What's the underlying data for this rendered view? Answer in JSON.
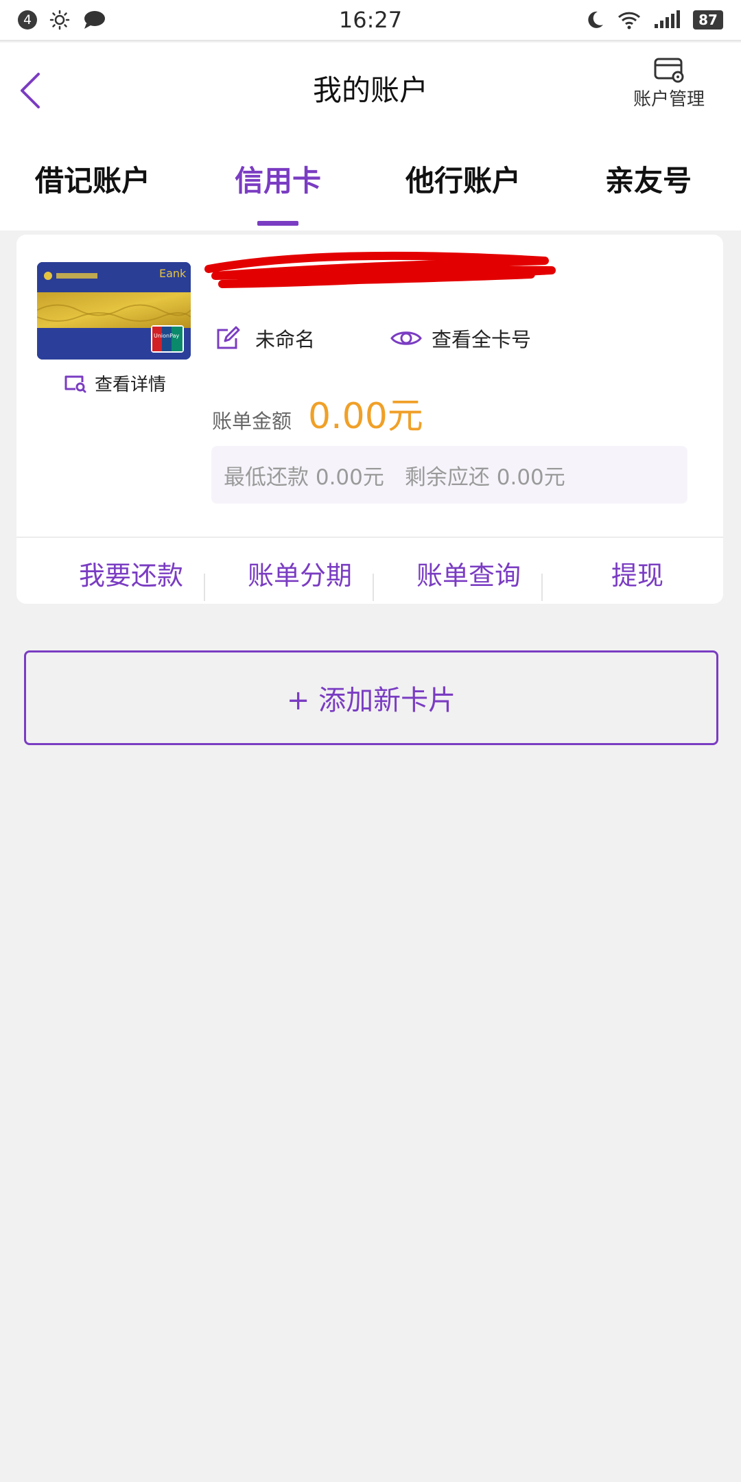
{
  "status_bar": {
    "notification_count": "4",
    "time": "16:27",
    "battery": "87"
  },
  "header": {
    "title": "我的账户",
    "manage_label": "账户管理"
  },
  "tabs": [
    {
      "label": "借记账户"
    },
    {
      "label": "信用卡"
    },
    {
      "label": "他行账户"
    },
    {
      "label": "亲友号"
    }
  ],
  "active_tab": "信用卡",
  "card": {
    "name": "未命名",
    "view_full_number": "查看全卡号",
    "view_detail": "查看详情",
    "bill_label": "账单金额",
    "bill_amount": "0.00元",
    "min_payment": "最低还款 0.00元",
    "remaining": "剩余应还 0.00元",
    "image_brand_text": "Eank",
    "image_network_text": "UnionPay"
  },
  "actions": [
    {
      "label": "我要还款"
    },
    {
      "label": "账单分期"
    },
    {
      "label": "账单查询"
    },
    {
      "label": "提现"
    }
  ],
  "add_card_label": "+ 添加新卡片",
  "colors": {
    "accent": "#7a3cc2",
    "amount": "#f0a028",
    "background": "#f1f1f1",
    "redaction": "#e30000"
  },
  "icons": {
    "back": "chevron-left-icon",
    "manage": "card-settings-icon",
    "rename": "edit-icon",
    "view": "eye-icon",
    "detail": "card-search-icon"
  }
}
